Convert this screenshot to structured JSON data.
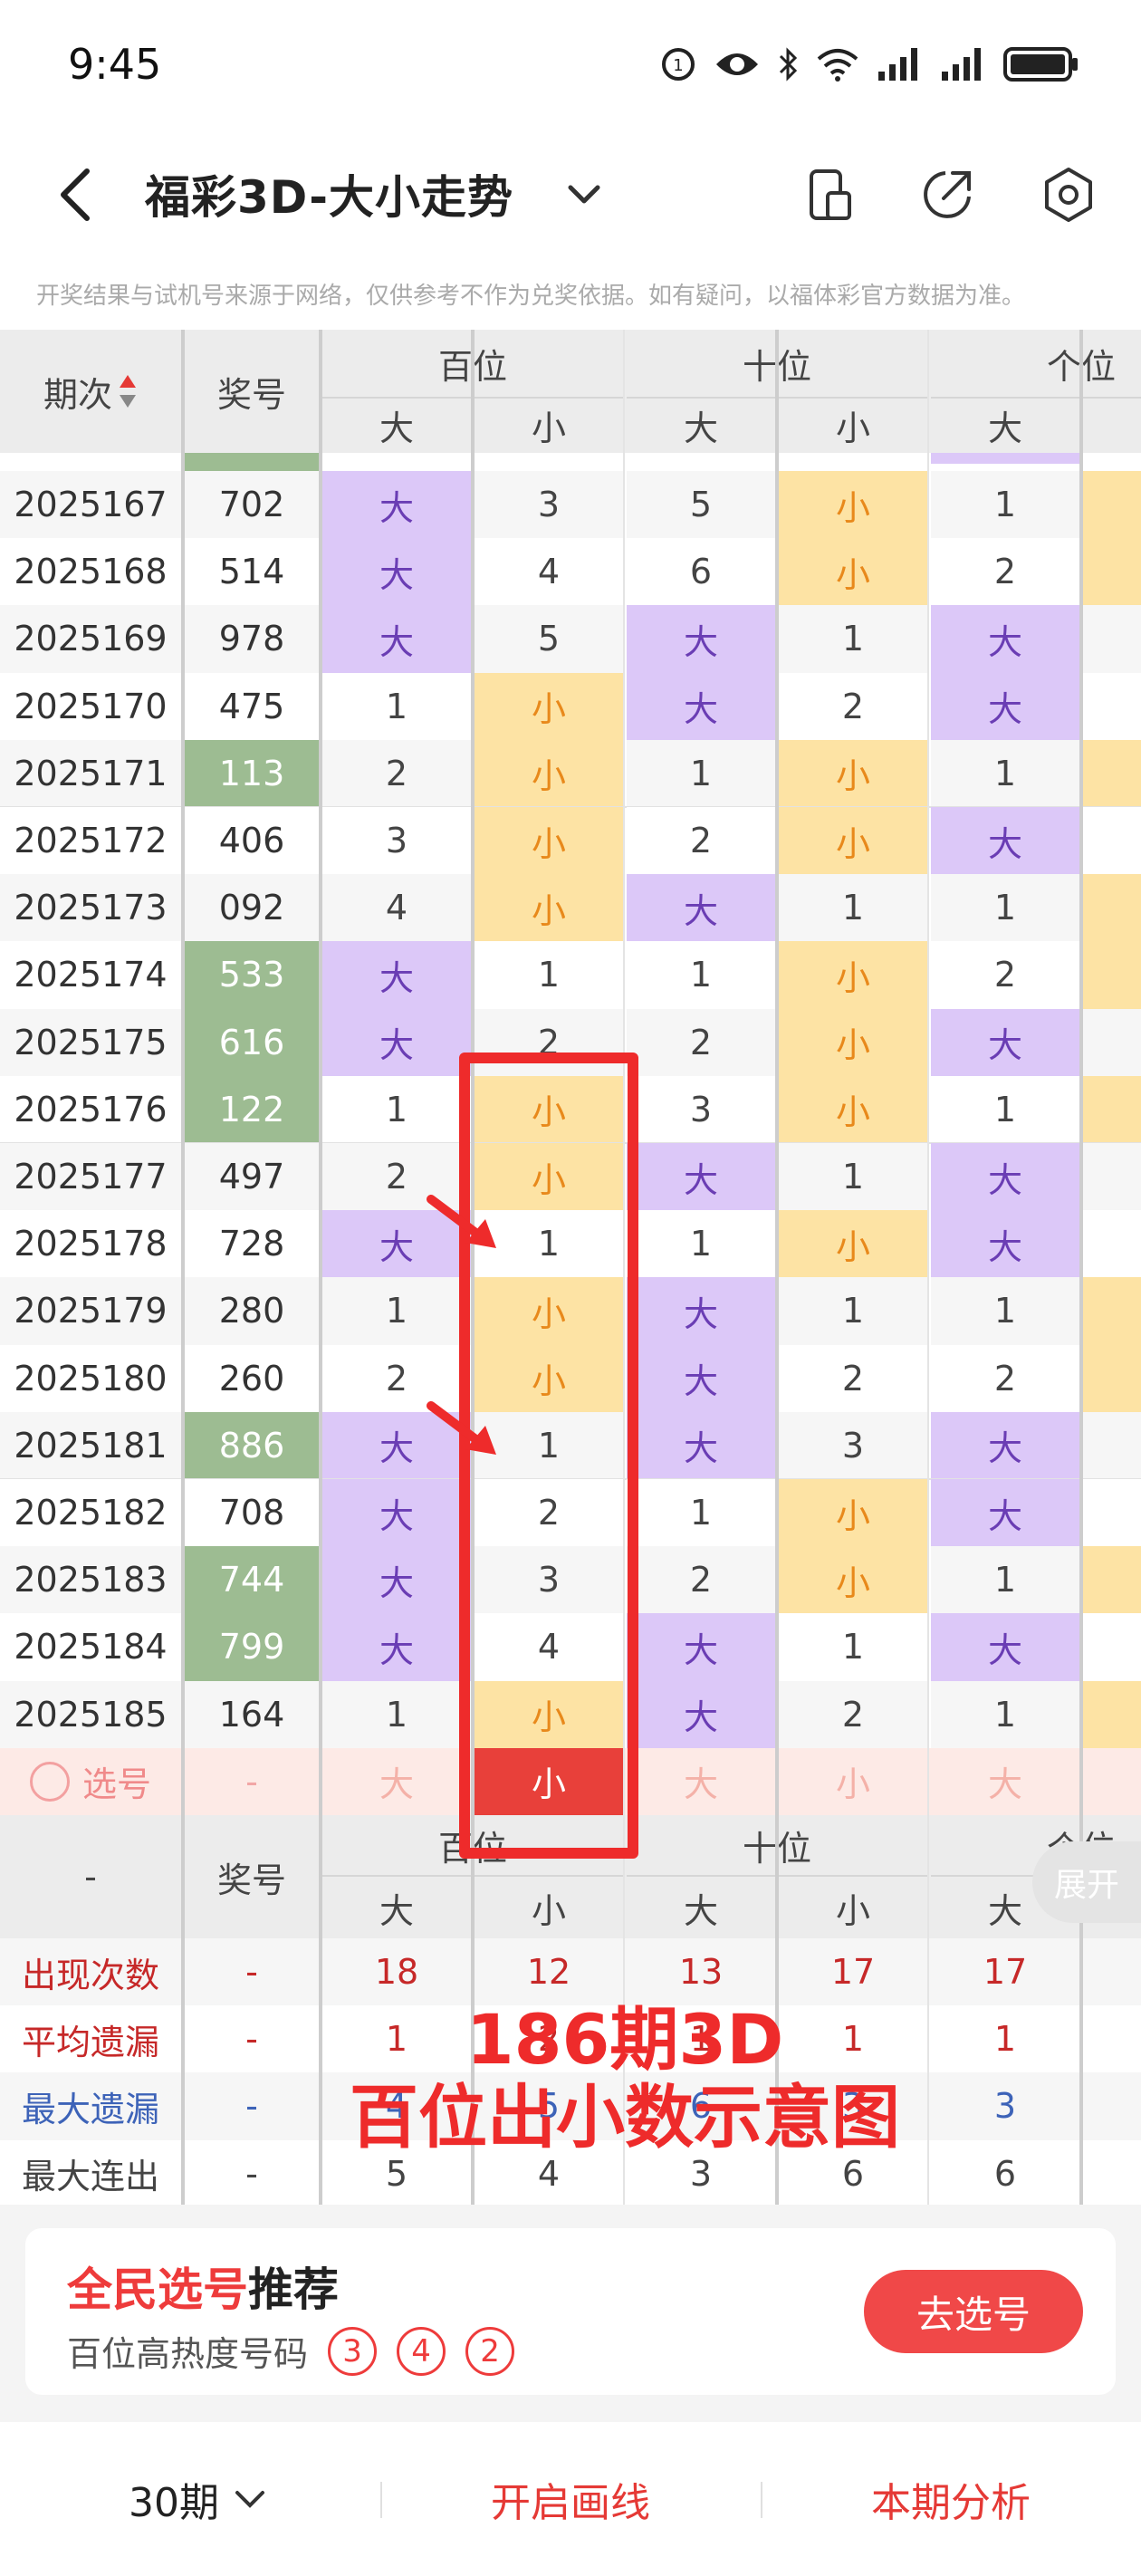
{
  "status_bar": {
    "time": "9:45",
    "battery_icon": "battery-icon",
    "signal_icon": "signal-icon",
    "wifi_icon": "wifi-icon"
  },
  "nav": {
    "title": "福彩3D-大小走势",
    "back_icon": "back-icon",
    "dropdown_icon": "chevron-down-icon",
    "icons": [
      "phone-layout-icon",
      "share-icon",
      "settings-icon"
    ]
  },
  "disclaimer": "开奖结果与试机号来源于网络，仅供参考不作为兑奖依据。如有疑问，以福体彩官方数据为准。",
  "table": {
    "col_issue": "期次",
    "col_number": "奖号",
    "groups": [
      "百位",
      "十位",
      "个位"
    ],
    "big": "大",
    "small": "小",
    "rows": [
      {
        "issue": "2025167",
        "num": "702",
        "hl": false,
        "cells": [
          [
            "B",
            "大"
          ],
          [
            "W",
            "3"
          ],
          [
            "W",
            "5"
          ],
          [
            "Y",
            "小"
          ],
          [
            "W",
            "1"
          ]
        ]
      },
      {
        "issue": "2025168",
        "num": "514",
        "hl": false,
        "cells": [
          [
            "B",
            "大"
          ],
          [
            "W",
            "4"
          ],
          [
            "W",
            "6"
          ],
          [
            "Y",
            "小"
          ],
          [
            "W",
            "2"
          ]
        ]
      },
      {
        "issue": "2025169",
        "num": "978",
        "hl": false,
        "cells": [
          [
            "B",
            "大"
          ],
          [
            "W",
            "5"
          ],
          [
            "P",
            "大"
          ],
          [
            "W",
            "1"
          ],
          [
            "P",
            "大"
          ]
        ]
      },
      {
        "issue": "2025170",
        "num": "475",
        "hl": false,
        "cells": [
          [
            "W",
            "1"
          ],
          [
            "Y",
            "小"
          ],
          [
            "P",
            "大"
          ],
          [
            "W",
            "2"
          ],
          [
            "P",
            "大"
          ]
        ]
      },
      {
        "issue": "2025171",
        "num": "113",
        "hl": true,
        "cells": [
          [
            "W",
            "2"
          ],
          [
            "Y",
            "小"
          ],
          [
            "W",
            "1"
          ],
          [
            "Y",
            "小"
          ],
          [
            "W",
            "1"
          ]
        ]
      },
      {
        "issue": "2025172",
        "num": "406",
        "hl": false,
        "cells": [
          [
            "W",
            "3"
          ],
          [
            "Y",
            "小"
          ],
          [
            "W",
            "2"
          ],
          [
            "Y",
            "小"
          ],
          [
            "P",
            "大"
          ]
        ]
      },
      {
        "issue": "2025173",
        "num": "092",
        "hl": false,
        "cells": [
          [
            "W",
            "4"
          ],
          [
            "Y",
            "小"
          ],
          [
            "P",
            "大"
          ],
          [
            "W",
            "1"
          ],
          [
            "W",
            "1"
          ]
        ]
      },
      {
        "issue": "2025174",
        "num": "533",
        "hl": true,
        "cells": [
          [
            "B",
            "大"
          ],
          [
            "W",
            "1"
          ],
          [
            "W",
            "1"
          ],
          [
            "Y",
            "小"
          ],
          [
            "W",
            "2"
          ]
        ]
      },
      {
        "issue": "2025175",
        "num": "616",
        "hl": true,
        "cells": [
          [
            "B",
            "大"
          ],
          [
            "W",
            "2"
          ],
          [
            "W",
            "2"
          ],
          [
            "Y",
            "小"
          ],
          [
            "P",
            "大"
          ]
        ]
      },
      {
        "issue": "2025176",
        "num": "122",
        "hl": true,
        "cells": [
          [
            "W",
            "1"
          ],
          [
            "Y",
            "小"
          ],
          [
            "W",
            "3"
          ],
          [
            "Y",
            "小"
          ],
          [
            "W",
            "1"
          ]
        ]
      },
      {
        "issue": "2025177",
        "num": "497",
        "hl": false,
        "cells": [
          [
            "W",
            "2"
          ],
          [
            "Y",
            "小"
          ],
          [
            "P",
            "大"
          ],
          [
            "W",
            "1"
          ],
          [
            "P",
            "大"
          ]
        ]
      },
      {
        "issue": "2025178",
        "num": "728",
        "hl": false,
        "cells": [
          [
            "B",
            "大"
          ],
          [
            "W",
            "1"
          ],
          [
            "W",
            "1"
          ],
          [
            "Y",
            "小"
          ],
          [
            "P",
            "大"
          ]
        ]
      },
      {
        "issue": "2025179",
        "num": "280",
        "hl": false,
        "cells": [
          [
            "W",
            "1"
          ],
          [
            "Y",
            "小"
          ],
          [
            "P",
            "大"
          ],
          [
            "W",
            "1"
          ],
          [
            "W",
            "1"
          ]
        ]
      },
      {
        "issue": "2025180",
        "num": "260",
        "hl": false,
        "cells": [
          [
            "W",
            "2"
          ],
          [
            "Y",
            "小"
          ],
          [
            "P",
            "大"
          ],
          [
            "W",
            "2"
          ],
          [
            "W",
            "2"
          ]
        ]
      },
      {
        "issue": "2025181",
        "num": "886",
        "hl": true,
        "cells": [
          [
            "B",
            "大"
          ],
          [
            "W",
            "1"
          ],
          [
            "P",
            "大"
          ],
          [
            "W",
            "3"
          ],
          [
            "P",
            "大"
          ]
        ]
      },
      {
        "issue": "2025182",
        "num": "708",
        "hl": false,
        "cells": [
          [
            "B",
            "大"
          ],
          [
            "W",
            "2"
          ],
          [
            "W",
            "1"
          ],
          [
            "Y",
            "小"
          ],
          [
            "P",
            "大"
          ]
        ]
      },
      {
        "issue": "2025183",
        "num": "744",
        "hl": true,
        "cells": [
          [
            "B",
            "大"
          ],
          [
            "W",
            "3"
          ],
          [
            "W",
            "2"
          ],
          [
            "Y",
            "小"
          ],
          [
            "W",
            "1"
          ]
        ]
      },
      {
        "issue": "2025184",
        "num": "799",
        "hl": true,
        "cells": [
          [
            "B",
            "大"
          ],
          [
            "W",
            "4"
          ],
          [
            "P",
            "大"
          ],
          [
            "W",
            "1"
          ],
          [
            "P",
            "大"
          ]
        ]
      },
      {
        "issue": "2025185",
        "num": "164",
        "hl": false,
        "cells": [
          [
            "W",
            "1"
          ],
          [
            "Y",
            "小"
          ],
          [
            "P",
            "大"
          ],
          [
            "W",
            "2"
          ],
          [
            "W",
            "1"
          ]
        ]
      }
    ],
    "pick_row": {
      "label": "选号",
      "num": "-",
      "cells": [
        "大",
        "小",
        "大",
        "小",
        "大"
      ],
      "selected_index": 1
    },
    "stats_header": {
      "issue": "-",
      "num": "奖号"
    },
    "stats": [
      {
        "label": "出现次数",
        "color": "#c62828",
        "dash": "-",
        "values": [
          "18",
          "12",
          "13",
          "17",
          "17"
        ]
      },
      {
        "label": "平均遗漏",
        "color": "#c62828",
        "dash": "-",
        "values": [
          "1",
          "2",
          "1",
          "1",
          "1"
        ]
      },
      {
        "label": "最大遗漏",
        "color": "#3d63b8",
        "dash": "-",
        "values": [
          "4",
          "5",
          "6",
          "3",
          "3"
        ]
      },
      {
        "label": "最大连出",
        "color": "#444444",
        "dash": "-",
        "values": [
          "5",
          "4",
          "3",
          "6",
          "6"
        ]
      }
    ]
  },
  "annotation": {
    "line1": "186期3D",
    "line2": "百位出小数示意图"
  },
  "expand_label": "展开",
  "recommend": {
    "title_red": "全民选号",
    "title_black": "推荐",
    "subtitle": "百位高热度号码",
    "balls": [
      "3",
      "4",
      "2"
    ],
    "button": "去选号"
  },
  "bottom_bar": {
    "periods": "30期",
    "draw_line": "开启画线",
    "analysis": "本期分析"
  },
  "colors": {
    "purple": "#dcc8f8",
    "yellow": "#fde3a4",
    "green": "#9dbc92",
    "red": "#ee2b2b",
    "orange_text": "#e8891b",
    "purple_text": "#6a3db4"
  }
}
